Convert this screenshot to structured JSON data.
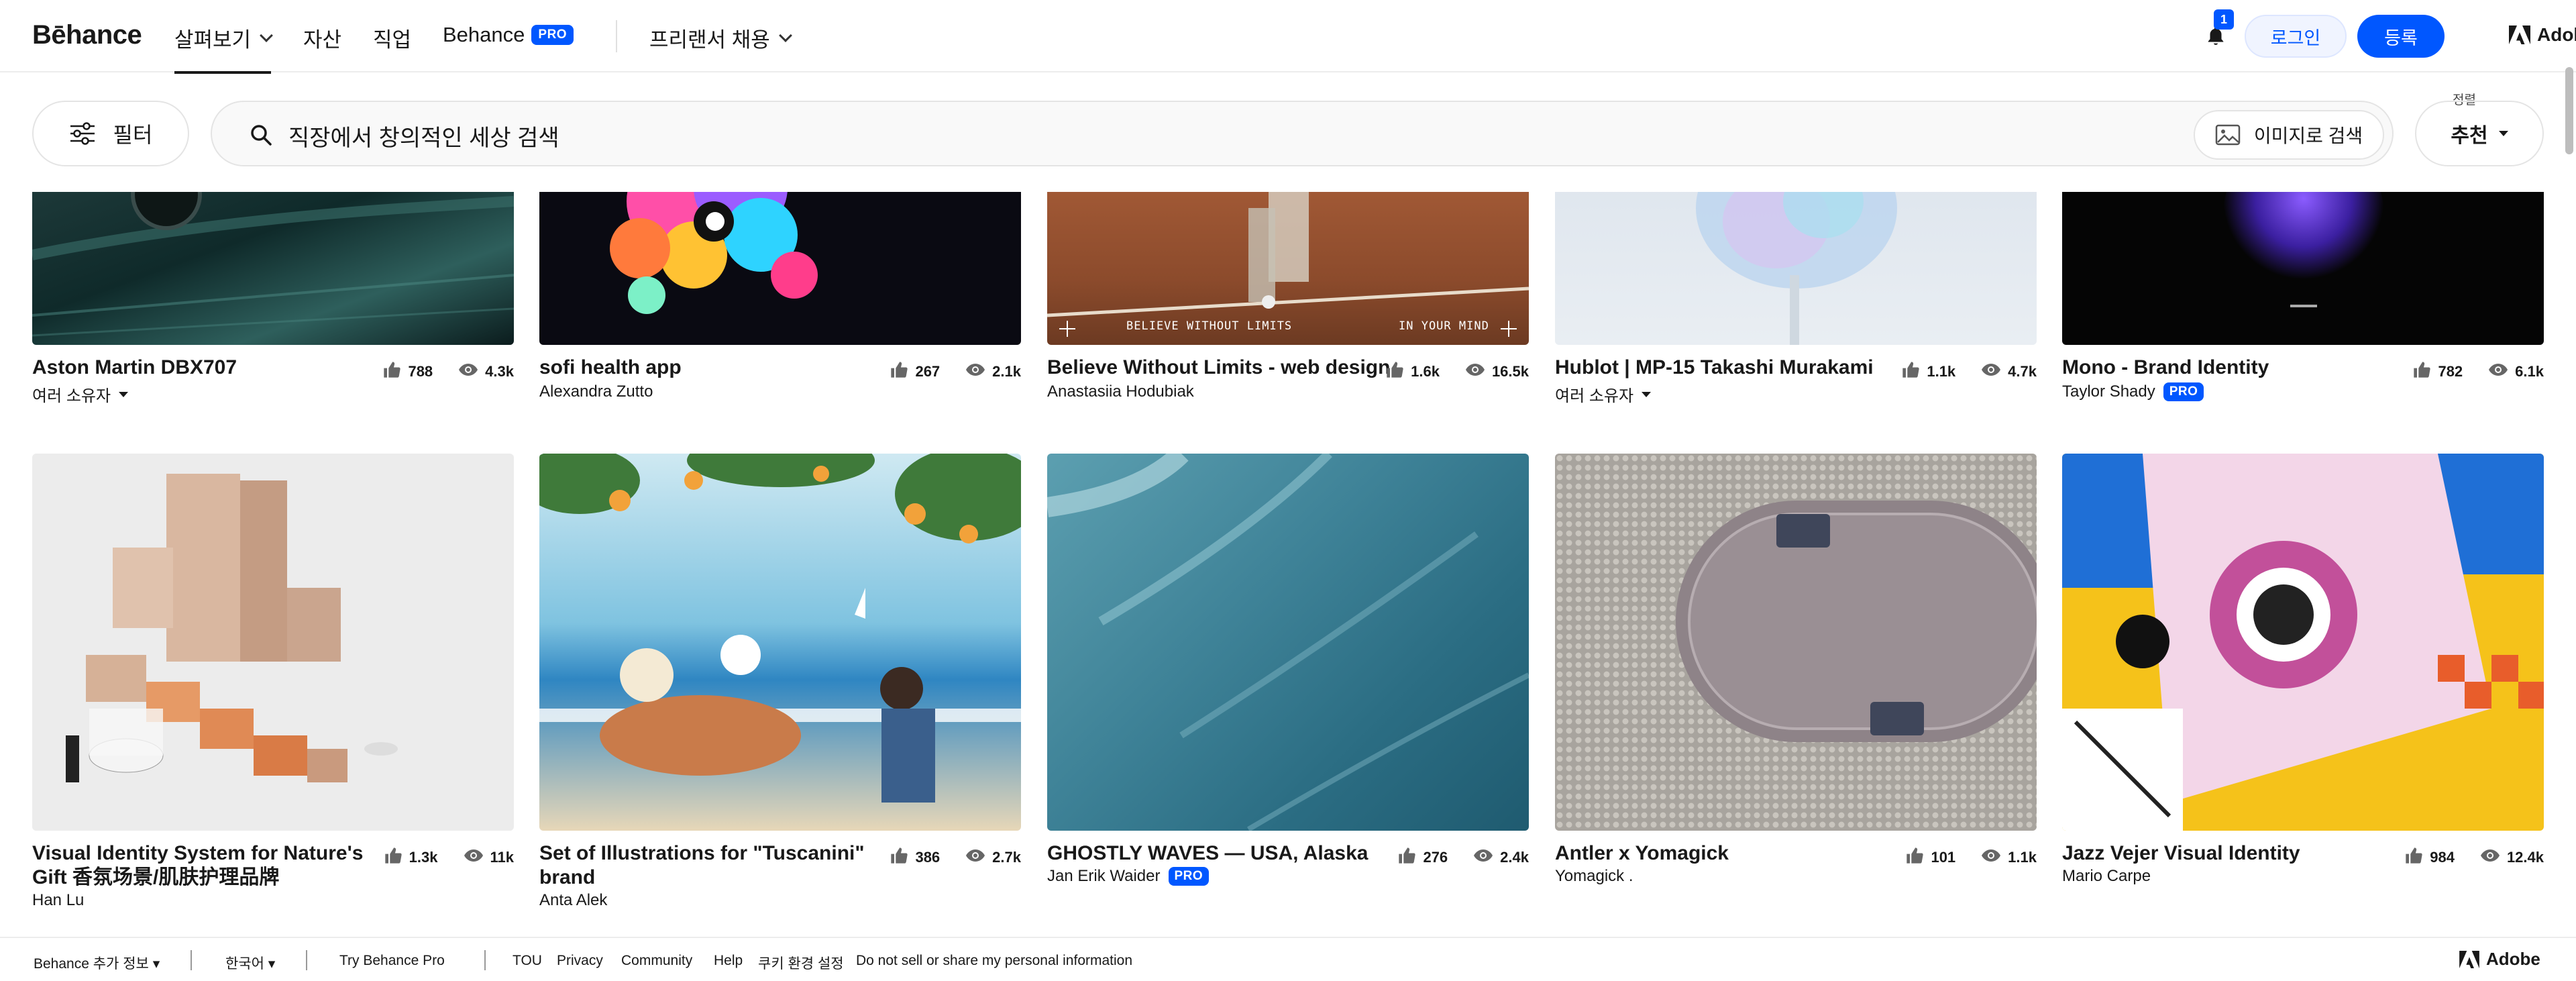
{
  "nav": {
    "logo": "Bēhance",
    "items": [
      "살펴보기",
      "자산",
      "직업"
    ],
    "behance_pro_label": "Behance",
    "pro_badge": "PRO",
    "freelance": "프리랜서 채용",
    "notifications_count": "1",
    "login": "로그인",
    "signup": "등록",
    "adobe": "Adobe",
    "accent": "#0057ff"
  },
  "search": {
    "filter": "필터",
    "query": "직장에서 창의적인 세상 검색",
    "image_search": "이미지로 검색",
    "sort_label": "정렬",
    "sort_value": "추천"
  },
  "projects_row1": [
    {
      "title": "Aston Martin DBX707",
      "owner": "여러 소유자",
      "owner_dropdown": true,
      "likes": "788",
      "views": "4.3k"
    },
    {
      "title": "sofi health app",
      "owner": "Alexandra Zutto",
      "likes": "267",
      "views": "2.1k"
    },
    {
      "title": "Believe Without Limits - web design",
      "owner": "Anastasiia Hodubiak",
      "likes": "1.6k",
      "views": "16.5k",
      "overlay_left": "BELIEVE WITHOUT LIMITS",
      "overlay_right": "IN YOUR MIND"
    },
    {
      "title": "Hublot | MP-15 Takashi Murakami",
      "owner": "여러 소유자",
      "owner_dropdown": true,
      "likes": "1.1k",
      "views": "4.7k"
    },
    {
      "title": "Mono - Brand Identity",
      "owner": "Taylor Shady",
      "owner_pro": "PRO",
      "likes": "782",
      "views": "6.1k"
    }
  ],
  "projects_row2": [
    {
      "title": "Visual Identity System for Nature's Gift 香氛场景/肌肤护理品牌",
      "owner": "Han Lu",
      "likes": "1.3k",
      "views": "11k"
    },
    {
      "title": "Set of Illustrations for \"Tuscanini\" brand",
      "owner": "Anta Alek",
      "likes": "386",
      "views": "2.7k"
    },
    {
      "title": "GHOSTLY WAVES — USA, Alaska",
      "owner": "Jan Erik Waider",
      "owner_pro": "PRO",
      "likes": "276",
      "views": "2.4k"
    },
    {
      "title": "Antler x Yomagick",
      "owner": "Yomagick .",
      "likes": "101",
      "views": "1.1k"
    },
    {
      "title": "Jazz Vejer Visual Identity",
      "owner": "Mario Carpe",
      "likes": "984",
      "views": "12.4k"
    }
  ],
  "footer": {
    "more": "Behance 추가 정보",
    "language": "한국어",
    "try_pro": "Try Behance Pro",
    "tou": "TOU",
    "privacy": "Privacy",
    "community": "Community",
    "help": "Help",
    "cookies": "쿠키 환경 설정",
    "dnsmpi": "Do not sell or share my personal information",
    "adobe": "Adobe"
  }
}
